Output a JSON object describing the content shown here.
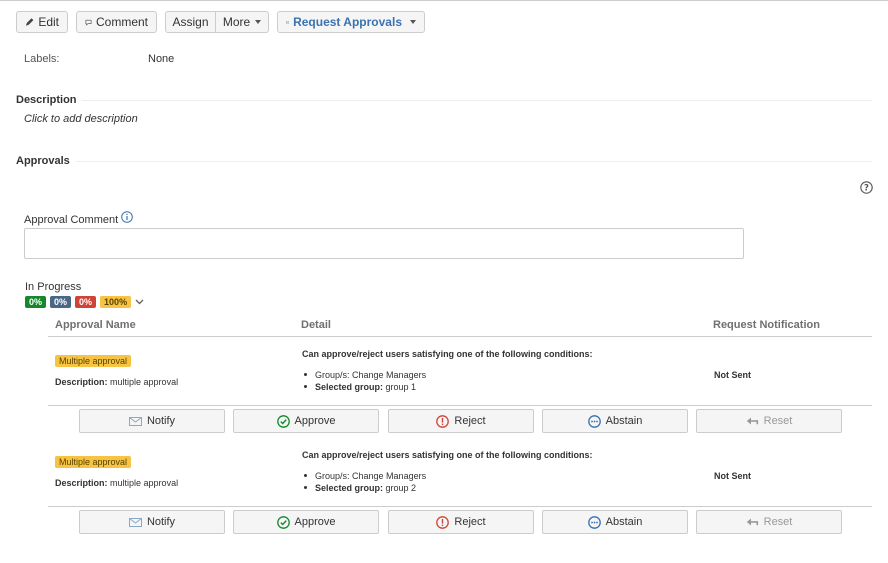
{
  "toolbar": {
    "edit_label": "Edit",
    "comment_label": "Comment",
    "assign_label": "Assign",
    "more_label": "More",
    "request_approvals_label": "Request Approvals"
  },
  "labels": {
    "key": "Labels:",
    "value": "None"
  },
  "description": {
    "heading": "Description",
    "placeholder": "Click to add description"
  },
  "approvals": {
    "heading": "Approvals",
    "comment_label": "Approval Comment",
    "comment_value": "",
    "status": "In Progress",
    "progress_badges": [
      "0%",
      "0%",
      "0%",
      "100%"
    ],
    "columns": [
      "Approval Name",
      "Detail",
      "Request Notification"
    ],
    "rows": [
      {
        "name": "Multiple approval",
        "desc_label": "Description:",
        "desc_value": "multiple approval",
        "cond_title": "Can approve/reject users satisfying one of the following conditions:",
        "cond_group_label": "Group/s:",
        "cond_group_value": "Change Managers",
        "cond_selected_label": "Selected group:",
        "cond_selected_value": "group 1",
        "notification": "Not Sent"
      },
      {
        "name": "Multiple approval",
        "desc_label": "Description:",
        "desc_value": "multiple approval",
        "cond_title": "Can approve/reject users satisfying one of the following conditions:",
        "cond_group_label": "Group/s:",
        "cond_group_value": "Change Managers",
        "cond_selected_label": "Selected group:",
        "cond_selected_value": "group 2",
        "notification": "Not Sent"
      }
    ],
    "actions": [
      "Notify",
      "Approve",
      "Reject",
      "Abstain",
      "Reset"
    ]
  },
  "colors": {
    "link_blue": "#3b73af",
    "approve_green": "#14892c",
    "reject_red": "#d04437",
    "abstain_blue": "#3572b0",
    "lozenge_yellow": "#f6c342"
  },
  "icons": {
    "edit": "pencil-icon",
    "comment": "speech-bubble-icon",
    "request": "envelope-icon",
    "help": "question-circle-icon",
    "info": "info-circle-icon",
    "notify": "envelope-icon",
    "approve": "check-circle-icon",
    "reject": "exclamation-circle-icon",
    "abstain": "ellipsis-circle-icon",
    "reset": "undo-arrow-icon"
  }
}
